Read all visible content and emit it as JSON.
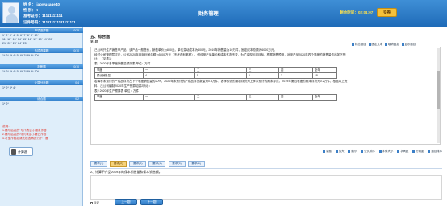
{
  "candidate": {
    "name_line": "姓 名：jiaowusage40",
    "gender_line": "性 别：X",
    "id_line": "准考证号：11111111111",
    "cert_line": "证件号码：111111111111111111"
  },
  "header": {
    "title": "财务管理",
    "time_label": "剩余时间：02:01:07",
    "submit_label": "交卷"
  },
  "sidebar": {
    "sections": [
      {
        "label": "单项选择题",
        "count": "0/25"
      },
      {
        "label": "多项选择题",
        "count": "0/10"
      },
      {
        "label": "判断题",
        "count": "0/10"
      },
      {
        "label": "计算分析题",
        "count": "0/4"
      },
      {
        "label": "综合题",
        "count": "0/2"
      }
    ],
    "number_rows": [
      "1* 2* 3* 4* 5* 6* 7* 8* 9* 10*",
      "11* 12* 13* 14* 15* 16* 17* 18* 19* 20*",
      "21* 22* 23* 24* 25*",
      "1* 2* 3* 4* 5* 6* 7* 8* 9* 10*",
      "1* 2* 3* 4* 5* 6* 7* 8* 9* 10*",
      "1* 2* 3* 4*",
      "1* 2*"
    ],
    "notes": [
      "说明：",
      "1.题号后边的*号代表该小题未作答",
      "2.题号后边的!号代表该小题已作答",
      "3.考生作答后请先核查再进行下一题"
    ],
    "calculator_label": "计算器"
  },
  "question": {
    "section_title": "五、综合题",
    "sub_label": "第1题",
    "tools": [
      "标志题目",
      "固定文本",
      "取消固定",
      "显示题目"
    ],
    "material_lines": [
      "己公司只生产销售甲产品，该产品一般售价，销售单价为800元，单位变动成本为400元，2019年销售量为10万件，固定成本总额为6000万元。",
      "经过公司管理层讨论，公司2020年目标利润总额为5000万元（不考虑利率税），假设甲产品单价和成本性态不变，为了实现利润目标，根据销售预测，对甲产品2020年四个季度的销售量作出如下预",
      "计。（见表1）",
      "表1  2020年各季度销售量预测表  单位：万件"
    ],
    "table1": {
      "header": [
        "季度",
        "一",
        "二",
        "三",
        "四",
        "全年"
      ],
      "row": [
        "预计销售量",
        "4",
        "5",
        "6",
        "3",
        "18"
      ]
    },
    "material_lines2": [
      "若每季末预计的产成品存货占下个季度销售量的20%，2020年末预计的产成品存货数量为0.5万件，各季预计的期初存货为上季末预计的期末存货。2019年第四季度的期末存货为0.2万件，根据以上资",
      "料，己公司编制2020年生产预算如表2所示：",
      "表2  2020年生产预算表  单位：万件"
    ],
    "table2": {
      "header": [
        "季度",
        "一",
        "二",
        "三",
        "四",
        "全年"
      ]
    },
    "bottom_tools": [
      "录题",
      "放大",
      "缩小",
      "公式排序",
      "字体大小",
      "字间距",
      "行间距",
      "题目排序"
    ],
    "tabs": [
      "要求(1)",
      "要求(2)",
      "要求(3)",
      "要求(4)",
      "要求(5)",
      "要求(6)"
    ],
    "active_tab": 1,
    "prompt": "2、计算甲产品2019年的保本销售量和保本销售额。",
    "mark_label": "标记",
    "prev_label": "上一题",
    "next_label": "下一题"
  }
}
